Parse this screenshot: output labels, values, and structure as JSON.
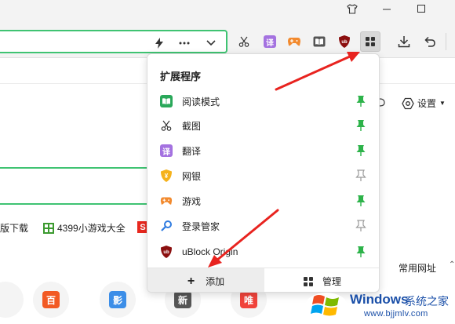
{
  "titlebar": {
    "icons": [
      "shirt-icon",
      "minimize-icon",
      "maximize-icon"
    ]
  },
  "toolbar": {
    "address_icons": [
      "lightning-icon",
      "more-icon",
      "chevron-down-icon"
    ],
    "extensions": [
      "screenshot-icon",
      "translate-icon",
      "game-icon",
      "reader-icon",
      "ublock-icon",
      "extensions-grid-icon"
    ],
    "right_icons": [
      "download-icon",
      "undo-icon"
    ]
  },
  "page": {
    "settings_label": "设置",
    "links": [
      {
        "text": "版下载"
      },
      {
        "text": "4399小游戏大全"
      }
    ],
    "common_url": "常用网址",
    "sites": [
      {
        "text": "百",
        "color": "#f25a24"
      },
      {
        "text": "影",
        "color": "#3c8ee8"
      },
      {
        "text": "新",
        "color": "#555555"
      },
      {
        "text": "唯",
        "color": "#f0433b"
      }
    ]
  },
  "popup": {
    "title": "扩展程序",
    "items": [
      {
        "name": "阅读模式",
        "icon": "reader-mode-icon",
        "pinned": true
      },
      {
        "name": "截图",
        "icon": "scissors-icon",
        "pinned": true
      },
      {
        "name": "翻译",
        "icon": "translate-icon",
        "pinned": true
      },
      {
        "name": "网银",
        "icon": "bank-shield-icon",
        "pinned": false
      },
      {
        "name": "游戏",
        "icon": "gamepad-icon",
        "pinned": true
      },
      {
        "name": "登录管家",
        "icon": "key-icon",
        "pinned": false
      },
      {
        "name": "uBlock Origin",
        "icon": "ublock-icon",
        "pinned": true
      }
    ],
    "add_label": "添加",
    "manage_label": "管理"
  },
  "watermark": {
    "title": "Windows",
    "subtitle": "系统之家",
    "url": "www.bjjmlv.com"
  },
  "colors": {
    "accent_green": "#3fc372",
    "pin_green": "#2db34a",
    "pin_gray": "#9a9a9a",
    "arrow_red": "#e8231f"
  }
}
